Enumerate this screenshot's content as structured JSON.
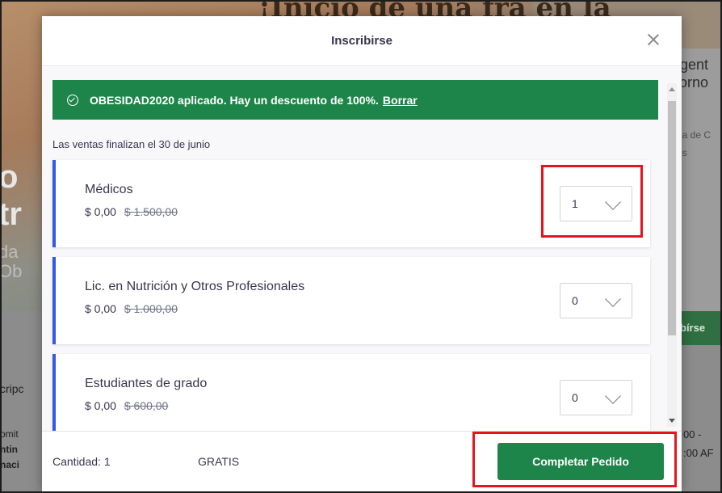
{
  "background": {
    "hero_text": "¡Inicio de una fra en la",
    "big_line1": "o",
    "big_line2": "tr",
    "faint_line1": "da",
    "faint_line2": "Ob",
    "right_title1": "rgent",
    "right_title2": "torno",
    "right_sub1": "na de C",
    "right_sub2": "os",
    "right_button": "bírse",
    "lower_text1": "cripc",
    "lower_text2": "omit",
    "lower_text3": "ntin",
    "lower_text4": "naci",
    "right_time1": "00 -",
    "right_time2": ":00 AF"
  },
  "modal": {
    "title": "Inscribirse",
    "promo": {
      "message": "OBESIDAD2020 aplicado. Hay un descuento de 100%.",
      "link": "Borrar"
    },
    "sales_end": "Las ventas finalizan el 30 de junio",
    "tickets": [
      {
        "name": "Médicos",
        "price": "$ 0,00",
        "original_price": "$ 1.500,00",
        "quantity": "1"
      },
      {
        "name": "Lic. en Nutrición y Otros Profesionales",
        "price": "$ 0,00",
        "original_price": "$ 1.000,00",
        "quantity": "0"
      },
      {
        "name": "Estudiantes de grado",
        "price": "$ 0,00",
        "original_price": "$ 600,00",
        "quantity": "0"
      }
    ],
    "footer": {
      "quantity_label": "Cantidad: 1",
      "total": "GRATIS",
      "checkout_label": "Completar Pedido"
    }
  },
  "colors": {
    "brand_green": "#1e854a",
    "ticket_accent": "#3659e3",
    "highlight_red": "#e8141b"
  }
}
